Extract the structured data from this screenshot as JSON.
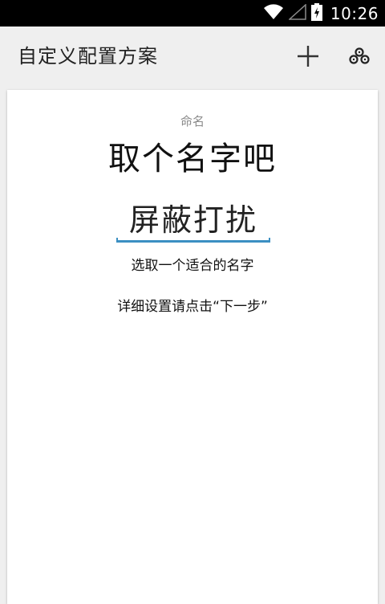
{
  "status_bar": {
    "time": "10:26",
    "icons": [
      "wifi-icon",
      "signal-icon",
      "battery-charging-icon"
    ]
  },
  "app_bar": {
    "title": "自定义配置方案",
    "actions": [
      {
        "icon": "plus-icon",
        "role": "add"
      },
      {
        "icon": "gears-icon",
        "role": "settings"
      }
    ]
  },
  "card": {
    "label": "命名",
    "headline": "取个名字吧",
    "name_value": "屏蔽打扰",
    "hint": "选取一个适合的名字",
    "detail": "详细设置请点击“下一步”"
  },
  "colors": {
    "status_bar_bg": "#000000",
    "app_bar_bg": "#efefef",
    "card_bg": "#ffffff",
    "accent_underline": "#3b8fc2"
  }
}
